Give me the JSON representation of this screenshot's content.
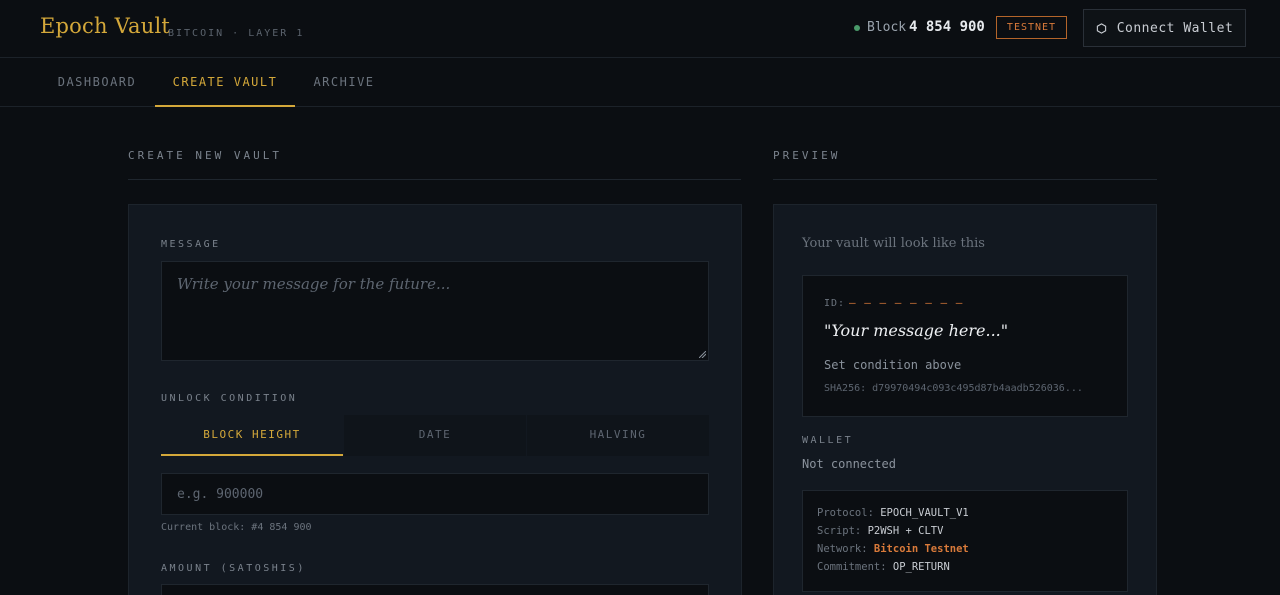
{
  "header": {
    "title": "Epoch Vault",
    "subtitle": "BITCOIN · LAYER 1",
    "block_label": "Block",
    "block_number": "4 854 900",
    "network_badge": "TESTNET",
    "connect_label": "Connect Wallet"
  },
  "nav": {
    "tabs": [
      {
        "label": "DASHBOARD"
      },
      {
        "label": "CREATE VAULT"
      },
      {
        "label": "ARCHIVE"
      }
    ],
    "active": "CREATE VAULT"
  },
  "create": {
    "section_title": "CREATE NEW VAULT",
    "message_label": "MESSAGE",
    "message_placeholder": "Write your message for the future...",
    "unlock_label": "UNLOCK CONDITION",
    "conditions": [
      {
        "label": "BLOCK HEIGHT"
      },
      {
        "label": "DATE"
      },
      {
        "label": "HALVING"
      }
    ],
    "active_condition": "BLOCK HEIGHT",
    "block_placeholder": "e.g. 900000",
    "current_block": "Current block: #4 854 900",
    "amount_label": "AMOUNT (SATOSHIS)"
  },
  "preview": {
    "section_title": "PREVIEW",
    "heading": "Your vault will look like this",
    "id_label": "ID:",
    "id_value": "— — — — — — — —",
    "message": "\"Your message here...\"",
    "condition": "Set condition above",
    "sha": "SHA256: d79970494c093c495d87b4aadb526036...",
    "wallet_label": "WALLET",
    "wallet_status": "Not connected",
    "protocol": {
      "protocol_label": "Protocol:",
      "protocol_value": "EPOCH_VAULT_V1",
      "script_label": "Script:",
      "script_value": "P2WSH + CLTV",
      "network_label": "Network:",
      "network_value": "Bitcoin Testnet",
      "commitment_label": "Commitment:",
      "commitment_value": "OP_RETURN"
    }
  },
  "colors": {
    "accent": "#d4a83a",
    "testnet": "#d97a3a",
    "status_dot": "#4a9a6a",
    "background": "#0b0e12",
    "panel": "#121820"
  }
}
